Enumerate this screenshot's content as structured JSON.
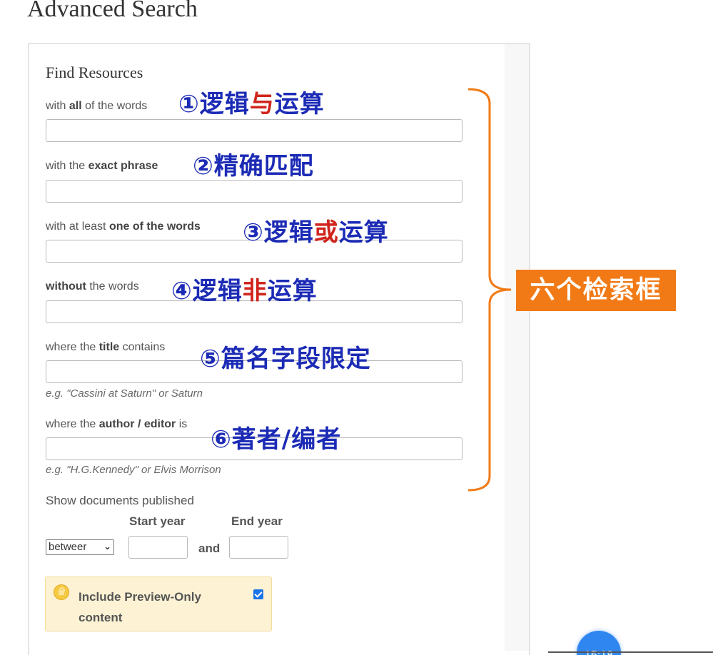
{
  "page": {
    "title": "Advanced Search"
  },
  "form": {
    "section_title": "Find Resources",
    "fields": [
      {
        "label_parts": [
          "with ",
          "all",
          " of the words"
        ],
        "value": "",
        "hint": ""
      },
      {
        "label_parts": [
          "with the ",
          "exact phrase",
          ""
        ],
        "value": "",
        "hint": ""
      },
      {
        "label_parts": [
          "with at least ",
          "one of the words",
          ""
        ],
        "value": "",
        "hint": ""
      },
      {
        "label_parts": [
          "",
          "without",
          " the words"
        ],
        "value": "",
        "hint": ""
      },
      {
        "label_parts": [
          "where the ",
          "title",
          " contains"
        ],
        "value": "",
        "hint": "e.g. \"Cassini at Saturn\" or Saturn"
      },
      {
        "label_parts": [
          "where the ",
          "author / editor",
          " is"
        ],
        "value": "",
        "hint": "e.g. \"H.G.Kennedy\" or Elvis Morrison"
      }
    ],
    "date_filter": {
      "label": "Show documents published",
      "start_year_label": "Start year",
      "end_year_label": "End year",
      "range_select_value": "betweer",
      "and_label": "and",
      "start_year_value": "",
      "end_year_value": ""
    },
    "preview": {
      "label": "Include Preview-Only content",
      "checked": true
    }
  },
  "annotations": {
    "items": [
      {
        "prefix": "①逻辑",
        "highlight": "与",
        "suffix": "运算"
      },
      {
        "prefix": "②精确匹配",
        "highlight": "",
        "suffix": ""
      },
      {
        "prefix": "③逻辑",
        "highlight": "或",
        "suffix": "运算"
      },
      {
        "prefix": "④逻辑",
        "highlight": "非",
        "suffix": "运算"
      },
      {
        "prefix": "⑤篇名字段限定",
        "highlight": "",
        "suffix": ""
      },
      {
        "prefix": "⑥著者/编者",
        "highlight": "",
        "suffix": ""
      }
    ],
    "brace_tag": "六个检索框",
    "colors": {
      "annotation_text": "#1c2bb5",
      "highlight_text": "#d0251d",
      "brace": "#f27a16",
      "tag_background": "#f27a16"
    }
  },
  "overlay": {
    "timer_text": "15:18"
  }
}
